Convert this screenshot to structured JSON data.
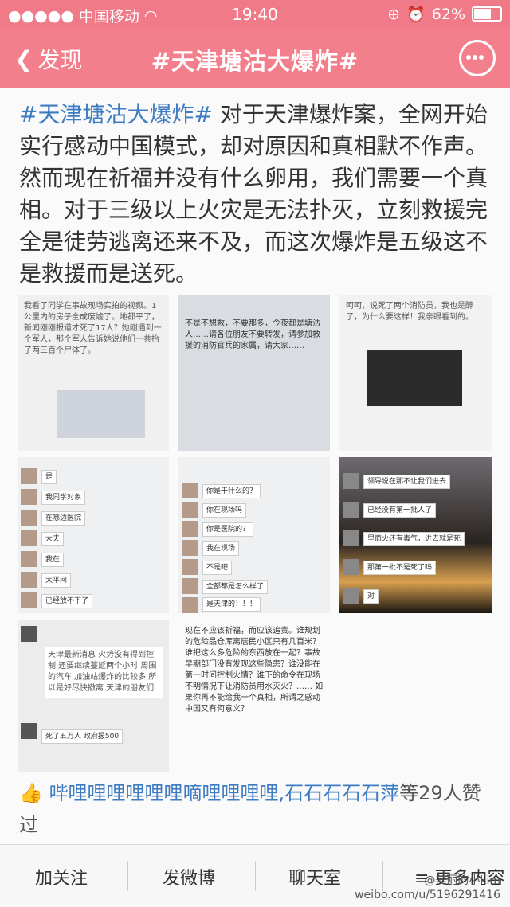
{
  "status_bar": {
    "carrier": "中国移动",
    "time": "19:40",
    "battery": "62%"
  },
  "nav": {
    "back_label": "发现",
    "title": "#天津塘沽大爆炸#"
  },
  "post": {
    "hashtag": "#天津塘沽大爆炸#",
    "body": "对于天津爆炸案，全网开始实行感动中国模式，却对原因和真相默不作声。然而现在祈福并没有什么卵用，我们需要一个真相。对于三级以上火灾是无法扑灭，立刻救援完全是徒劳逃离还来不及，而这次爆炸是五级这不是救援而是送死。"
  },
  "images": {
    "img1_text": "我看了同学在事故现场实拍的视频。1公里内的房子全成废墟了。地都平了，新闻刚刚报道才死了17人？她刚遇到一个军人，那个军人告诉她说他们一共抬了两三百个尸体了。",
    "img2_text": "不是不想救，不要那多，今夜都是塘沽人……请各位朋友不要转发，请参加救援的消防官兵的家属，请大家……",
    "img3_text": "呵呵，说死了两个消防员，我也是醉了，为什么要这样！我亲眼看到的。",
    "img4_chat": [
      "是",
      "我同学对象",
      "在哪边医院",
      "大夫",
      "我在",
      "太平间",
      "已经放不下了"
    ],
    "img5_chat": [
      "你是干什么的？",
      "你在现场吗",
      "你是医院的？",
      "我在现场",
      "不是吧",
      "全部都是怎么样了",
      "是天津的！！！"
    ],
    "img6_chat": [
      "领导说在那不让我们进去",
      "已经没有第一批人了",
      "里面火还有毒气，进去就是死",
      "那第一批不是死了吗",
      "对"
    ],
    "img7_text": "天津最新消息 火势没有得到控制 还要继续蔓延两个小时 周围的汽车 加油站爆炸的比较多 所以是好尽快撤离 天津的朋友们",
    "img7_text2": "死了五万人 政府报500",
    "img8_text": "现在不应该祈福，而应该追责。谁规划的危险品仓库离居民小区只有几百米？谁把这么多危险的东西放在一起？事故早期部门没有发现这些隐患？谁没能在第一时间控制火情？谁下的命令在现场不明情况下让消防员用水灭火？…… 如果你再不能给我一个真相，所谓之感动中国又有何意义？"
  },
  "likes": {
    "names": "哔哩哩哩哩哩哩嘀哩哩哩哩,石石石石石萍",
    "suffix": "等29人赞过"
  },
  "bottom_bar": {
    "tab1": "加关注",
    "tab2": "发微博",
    "tab3": "聊天室",
    "tab4": "更多内容"
  },
  "watermark": {
    "line1": "@美丽的小kim",
    "line2": "weibo.com/u/5196291416"
  }
}
